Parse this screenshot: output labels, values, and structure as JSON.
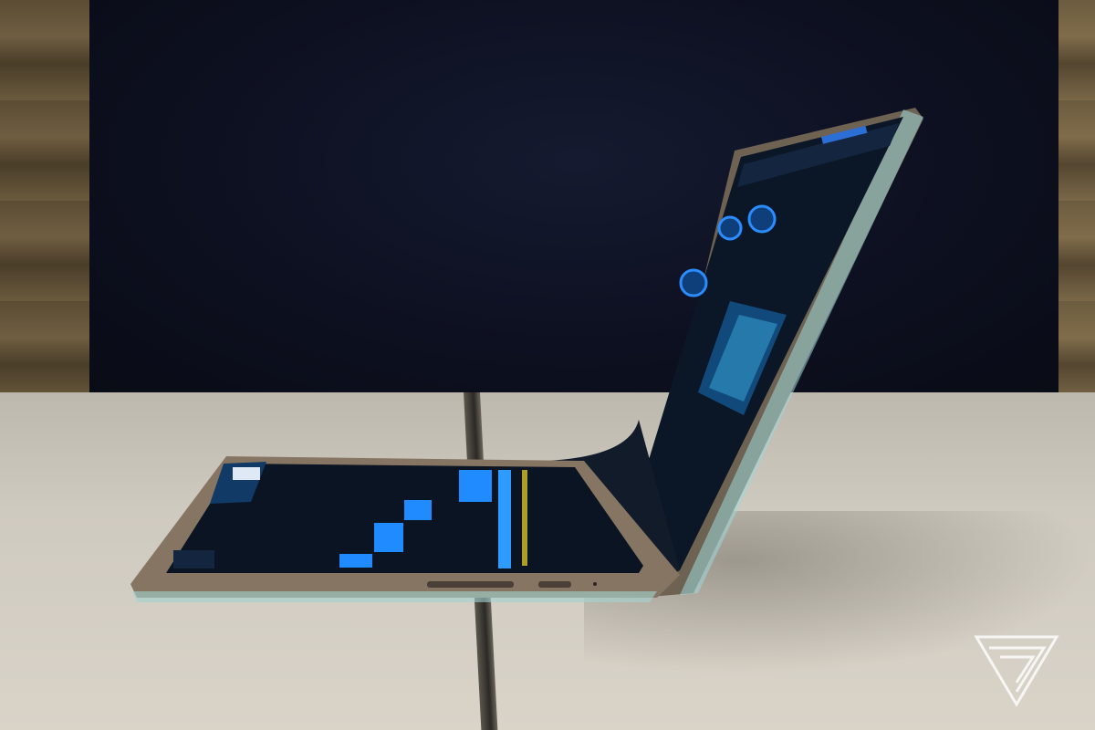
{
  "photo": {
    "subject": "foldable-laptop-on-table",
    "colors": {
      "screen_accent": "#1f8bff",
      "screen_bg": "#0b1626",
      "bezel": "#8b7a66",
      "table": "#d3cdc2",
      "background_curtain": "#0d1020"
    },
    "watermark_icon": "verge-v-logo"
  }
}
